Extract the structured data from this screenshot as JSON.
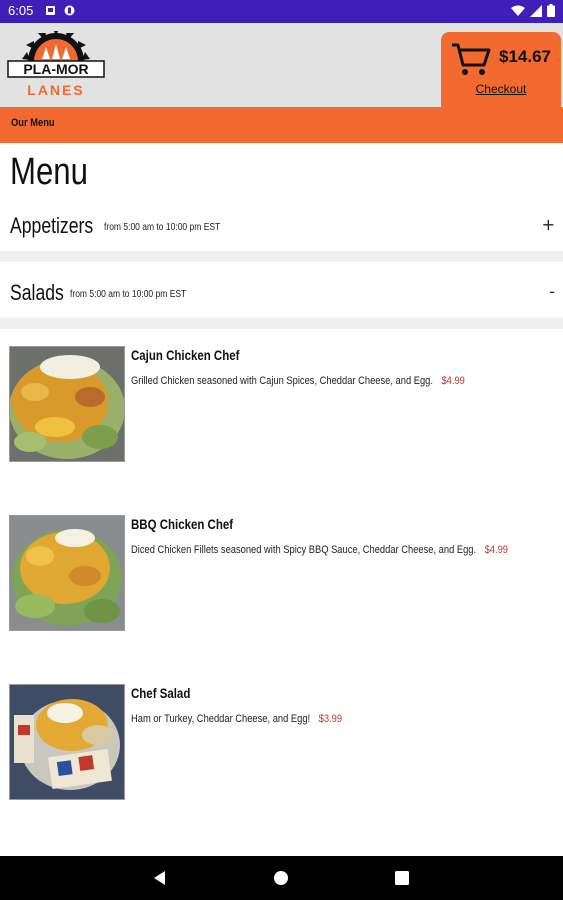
{
  "status": {
    "time": "6:05"
  },
  "header": {
    "logo": {
      "line1": "PLA-MOR",
      "line2": "LANES"
    },
    "cart_total": "$14.67",
    "checkout_label": "Checkout"
  },
  "breadcrumb": "Our Menu",
  "menu": {
    "title": "Menu",
    "sections": [
      {
        "name": "Appetizers",
        "hours": "from 5:00 am to 10:00 pm EST",
        "toggle": "+"
      },
      {
        "name": "Salads",
        "hours": "from 5:00 am to 10:00 pm EST",
        "toggle": "-"
      }
    ],
    "items": [
      {
        "name": "Cajun Chicken Chef",
        "description": "Grilled Chicken seasoned with Cajun Spices, Cheddar Cheese, and Egg.",
        "price": "$4.99"
      },
      {
        "name": "BBQ Chicken Chef",
        "description": "Diced Chicken Fillets seasoned with Spicy BBQ Sauce, Cheddar Cheese, and Egg.",
        "price": "$4.99"
      },
      {
        "name": "Chef Salad",
        "description": "Ham or Turkey, Cheddar Cheese, and Egg!",
        "price": "$3.99"
      }
    ]
  },
  "colors": {
    "accent": "#f26a2f",
    "status_bar": "#3f1fb8",
    "price": "#c0392b"
  },
  "icons": [
    "cart-icon",
    "back-icon",
    "home-icon",
    "recents-icon",
    "wifi-icon",
    "signal-icon",
    "battery-icon"
  ]
}
